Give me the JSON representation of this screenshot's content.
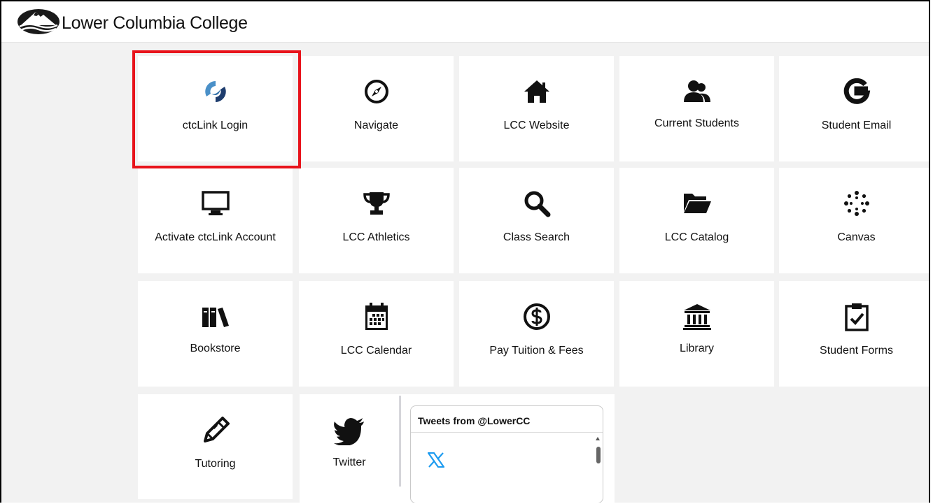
{
  "header": {
    "brand": "Lower Columbia College",
    "logo_icon": "mountain-waves-logo"
  },
  "tiles": [
    {
      "label": "ctcLink Login",
      "icon": "ctclink-logo-icon"
    },
    {
      "label": "Navigate",
      "icon": "compass-icon"
    },
    {
      "label": "LCC Website",
      "icon": "home-icon"
    },
    {
      "label": "Current Students",
      "icon": "users-icon"
    },
    {
      "label": "Student Email",
      "icon": "google-icon"
    },
    {
      "label": "Activate ctcLink Account",
      "icon": "monitor-icon"
    },
    {
      "label": "LCC Athletics",
      "icon": "trophy-icon"
    },
    {
      "label": "Class Search",
      "icon": "search-icon"
    },
    {
      "label": "LCC Catalog",
      "icon": "folder-open-icon"
    },
    {
      "label": "Canvas",
      "icon": "canvas-logo-icon"
    },
    {
      "label": "Bookstore",
      "icon": "books-icon"
    },
    {
      "label": "LCC Calendar",
      "icon": "calendar-icon"
    },
    {
      "label": "Pay Tuition & Fees",
      "icon": "dollar-circle-icon"
    },
    {
      "label": "Library",
      "icon": "bank-icon"
    },
    {
      "label": "Student Forms",
      "icon": "clipboard-check-icon"
    },
    {
      "label": "Tutoring",
      "icon": "pencil-icon"
    }
  ],
  "twitter": {
    "label": "Twitter",
    "icon": "twitter-bird-icon"
  },
  "tweets": {
    "title": "Tweets from @LowerCC",
    "icon": "x-logo-icon"
  },
  "colors": {
    "highlight": "#e8131b",
    "background": "#f2f2f2",
    "tile": "#ffffff",
    "x_logo": "#1d9bf0"
  }
}
